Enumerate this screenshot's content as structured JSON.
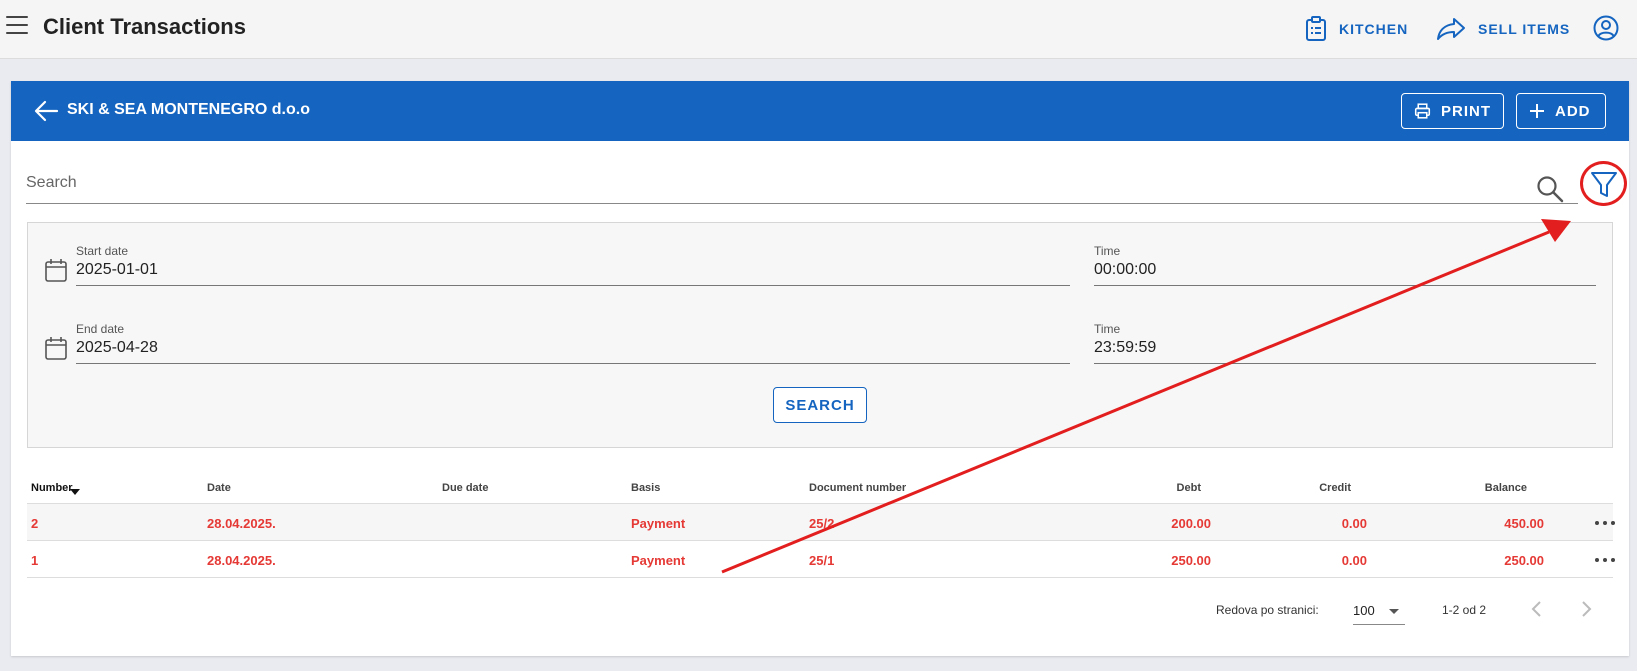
{
  "appbar": {
    "title": "Client Transactions",
    "kitchen_label": "KITCHEN",
    "sell_label": "SELL ITEMS"
  },
  "card": {
    "client_name": "SKI & SEA MONTENEGRO d.o.o",
    "print_label": "PRINT",
    "add_label": "ADD"
  },
  "search": {
    "placeholder": "Search"
  },
  "filters": {
    "start_date_label": "Start date",
    "start_date_value": "2025-01-01",
    "start_time_label": "Time",
    "start_time_value": "00:00:00",
    "end_date_label": "End date",
    "end_date_value": "2025-04-28",
    "end_time_label": "Time",
    "end_time_value": "23:59:59",
    "search_button": "SEARCH"
  },
  "table": {
    "headers": {
      "number": "Number",
      "date": "Date",
      "due_date": "Due date",
      "basis": "Basis",
      "document_number": "Document number",
      "debt": "Debt",
      "credit": "Credit",
      "balance": "Balance"
    },
    "rows": [
      {
        "number": "2",
        "date": "28.04.2025.",
        "due_date": "",
        "basis": "Payment",
        "document_number": "25/2",
        "debt": "200.00",
        "credit": "0.00",
        "balance": "450.00"
      },
      {
        "number": "1",
        "date": "28.04.2025.",
        "due_date": "",
        "basis": "Payment",
        "document_number": "25/1",
        "debt": "250.00",
        "credit": "0.00",
        "balance": "250.00"
      }
    ]
  },
  "pagination": {
    "rows_per_page_label": "Redova po stranici:",
    "rows_per_page_value": "100",
    "range": "1-2 od 2"
  },
  "colors": {
    "primary": "#1565c0",
    "row_text": "#e53935",
    "annotation": "#e31e1e"
  }
}
